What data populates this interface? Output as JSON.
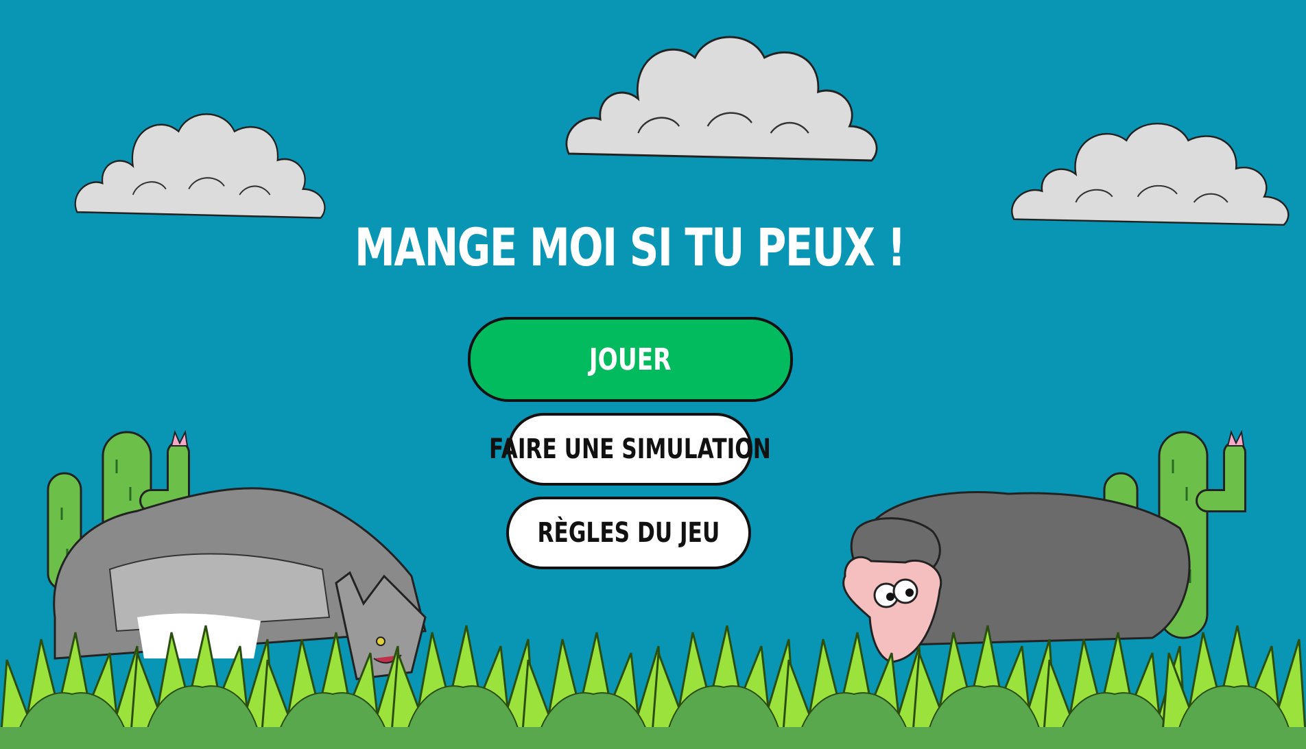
{
  "title": "MANGE MOI SI TU PEUX !",
  "buttons": {
    "play": "JOUER",
    "simulation": "FAIRE UNE SIMULATION",
    "rules": "RÈGLES DU JEU"
  },
  "colors": {
    "sky": "#0996b4",
    "play_button": "#02bb5e",
    "cloud": "#dcdcdc",
    "grass_dark": "#5aa84e",
    "grass_light": "#9be23d",
    "cactus": "#6cc04a",
    "wolf": "#8a8a8a",
    "sheep_wool": "#6b6b6b",
    "sheep_face": "#f5bfc0"
  },
  "icons": {
    "cloud": "cloud-icon",
    "cactus": "cactus-icon",
    "wolf": "wolf-icon",
    "sheep": "sheep-icon",
    "grass": "grass-icon"
  }
}
